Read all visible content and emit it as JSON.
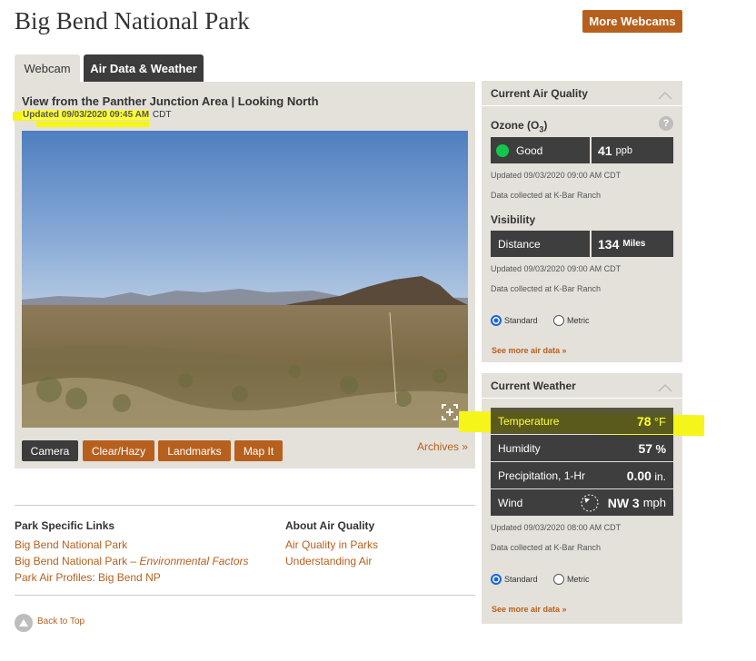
{
  "page": {
    "title": "Big Bend National Park",
    "more_webcams": "More Webcams"
  },
  "tabs": [
    {
      "label": "Webcam"
    },
    {
      "label": "Air Data & Weather"
    }
  ],
  "webcam": {
    "view_title": "View from the Panther Junction Area | Looking North",
    "updated_label": "Updated 09/03/2020 09:45 AM",
    "updated_tz": "CDT",
    "buttons": [
      "Camera",
      "Clear/Hazy",
      "Landmarks",
      "Map It"
    ],
    "archives": "Archives »"
  },
  "links": {
    "park_heading": "Park Specific Links",
    "park_links": [
      "Big Bend National Park",
      "Big Bend National Park –",
      "Environmental Factors",
      "Park Air Profiles: Big Bend NP"
    ],
    "air_heading": "About Air Quality",
    "air_links": [
      "Air Quality in Parks",
      "Understanding Air"
    ],
    "back_to_top": "Back to Top"
  },
  "air_quality": {
    "heading": "Current Air Quality",
    "ozone_label": "Ozone (O",
    "ozone_sub": "3",
    "ozone_close": ")",
    "help": "?",
    "ozone_status": "Good",
    "ozone_value": "41",
    "ozone_unit": "ppb",
    "ozone_updated": "Updated 09/03/2020 09:00 AM CDT",
    "ozone_source": "Data collected at K-Bar Ranch",
    "visibility_label": "Visibility",
    "distance_label": "Distance",
    "distance_value": "134",
    "distance_unit": "Miles",
    "vis_updated": "Updated 09/03/2020 09:00 AM CDT",
    "vis_source": "Data collected at K-Bar Ranch",
    "standard": "Standard",
    "metric": "Metric",
    "see_more": "See more air data »"
  },
  "weather": {
    "heading": "Current Weather",
    "temperature_label": "Temperature",
    "temperature_value": "78",
    "temperature_unit": "°F",
    "humidity_label": "Humidity",
    "humidity_value": "57",
    "humidity_unit": "%",
    "precip_label": "Precipitation, 1-Hr",
    "precip_value": "0.00",
    "precip_unit": "in.",
    "wind_label": "Wind",
    "wind_value": "NW 3",
    "wind_unit": "mph",
    "updated": "Updated 09/03/2020 08:00 AM CDT",
    "source": "Data collected at K-Bar Ranch",
    "standard": "Standard",
    "metric": "Metric",
    "see_more": "See more air data »"
  },
  "colors": {
    "accent": "#b7601e",
    "dark_cell": "#3e3e3e",
    "panel": "#e4e1db",
    "highlight": "#ffff33",
    "good": "#12c84a"
  },
  "icons": [
    "expand-icon",
    "help-icon",
    "chevron-up-icon",
    "compass-icon",
    "arrow-up-icon",
    "status-dot-icon"
  ]
}
